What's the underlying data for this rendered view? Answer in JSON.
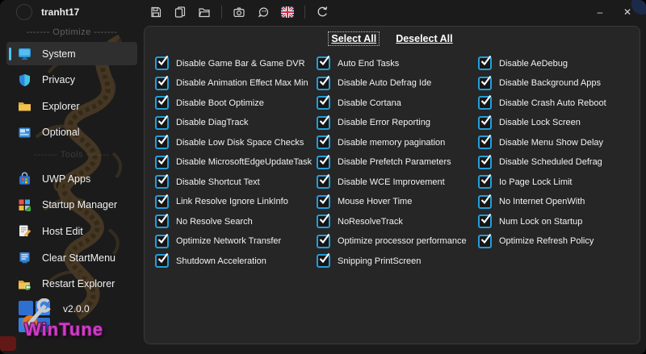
{
  "titlebar": {
    "username": "tranht17",
    "minimize_glyph": "–",
    "close_glyph": "✕",
    "toolbar_icons": [
      "save",
      "copy",
      "open-folder",
      "screenshot",
      "theme",
      "language-flag-uk",
      "refresh"
    ]
  },
  "sidebar": {
    "section_optimize_label": "------- Optimize -------",
    "section_tools_label": "------- Tools -------",
    "items": [
      {
        "label": "System",
        "selected": true
      },
      {
        "label": "Privacy",
        "selected": false
      },
      {
        "label": "Explorer",
        "selected": false
      },
      {
        "label": "Optional",
        "selected": false
      },
      {
        "label": "UWP Apps",
        "selected": false
      },
      {
        "label": "Startup Manager",
        "selected": false
      },
      {
        "label": "Host Edit",
        "selected": false
      },
      {
        "label": "Clear StartMenu",
        "selected": false
      },
      {
        "label": "Restart Explorer",
        "selected": false
      }
    ],
    "version": "v2.0.0",
    "brand": "WinTune"
  },
  "main": {
    "select_all_label": "Select All",
    "deselect_all_label": "Deselect All",
    "all_checked": true,
    "columns": [
      {
        "items": [
          "Disable Game Bar & Game DVR",
          "Disable Animation Effect Max Min",
          "Disable Boot Optimize",
          "Disable DiagTrack",
          "Disable Low Disk Space Checks",
          "Disable MicrosoftEdgeUpdateTask",
          "Disable Shortcut Text",
          "Link Resolve Ignore LinkInfo",
          "No Resolve Search",
          "Optimize Network Transfer",
          "Shutdown Acceleration"
        ]
      },
      {
        "items": [
          "Auto End Tasks",
          "Disable Auto Defrag Ide",
          "Disable Cortana",
          "Disable Error Reporting",
          "Disable memory pagination",
          "Disable Prefetch Parameters",
          "Disable WCE Improvement",
          "Mouse Hover Time",
          "NoResolveTrack",
          "Optimize processor performance",
          "Snipping PrintScreen"
        ]
      },
      {
        "items": [
          "Disable AeDebug",
          "Disable Background Apps",
          "Disable Crash Auto Reboot",
          "Disable Lock Screen",
          "Disable Menu Show Delay",
          "Disable Scheduled Defrag",
          "Io Page Lock Limit",
          "No Internet OpenWith",
          "Num Lock on Startup",
          "Optimize Refresh Policy"
        ]
      }
    ]
  },
  "colors": {
    "accent_checkbox_blue": "#229fdc",
    "selected_pill_blue": "#4cc2ff",
    "brand_magenta": "#cf3ec5",
    "panel_bg": "#262626",
    "window_bg": "#1b1b1b"
  }
}
